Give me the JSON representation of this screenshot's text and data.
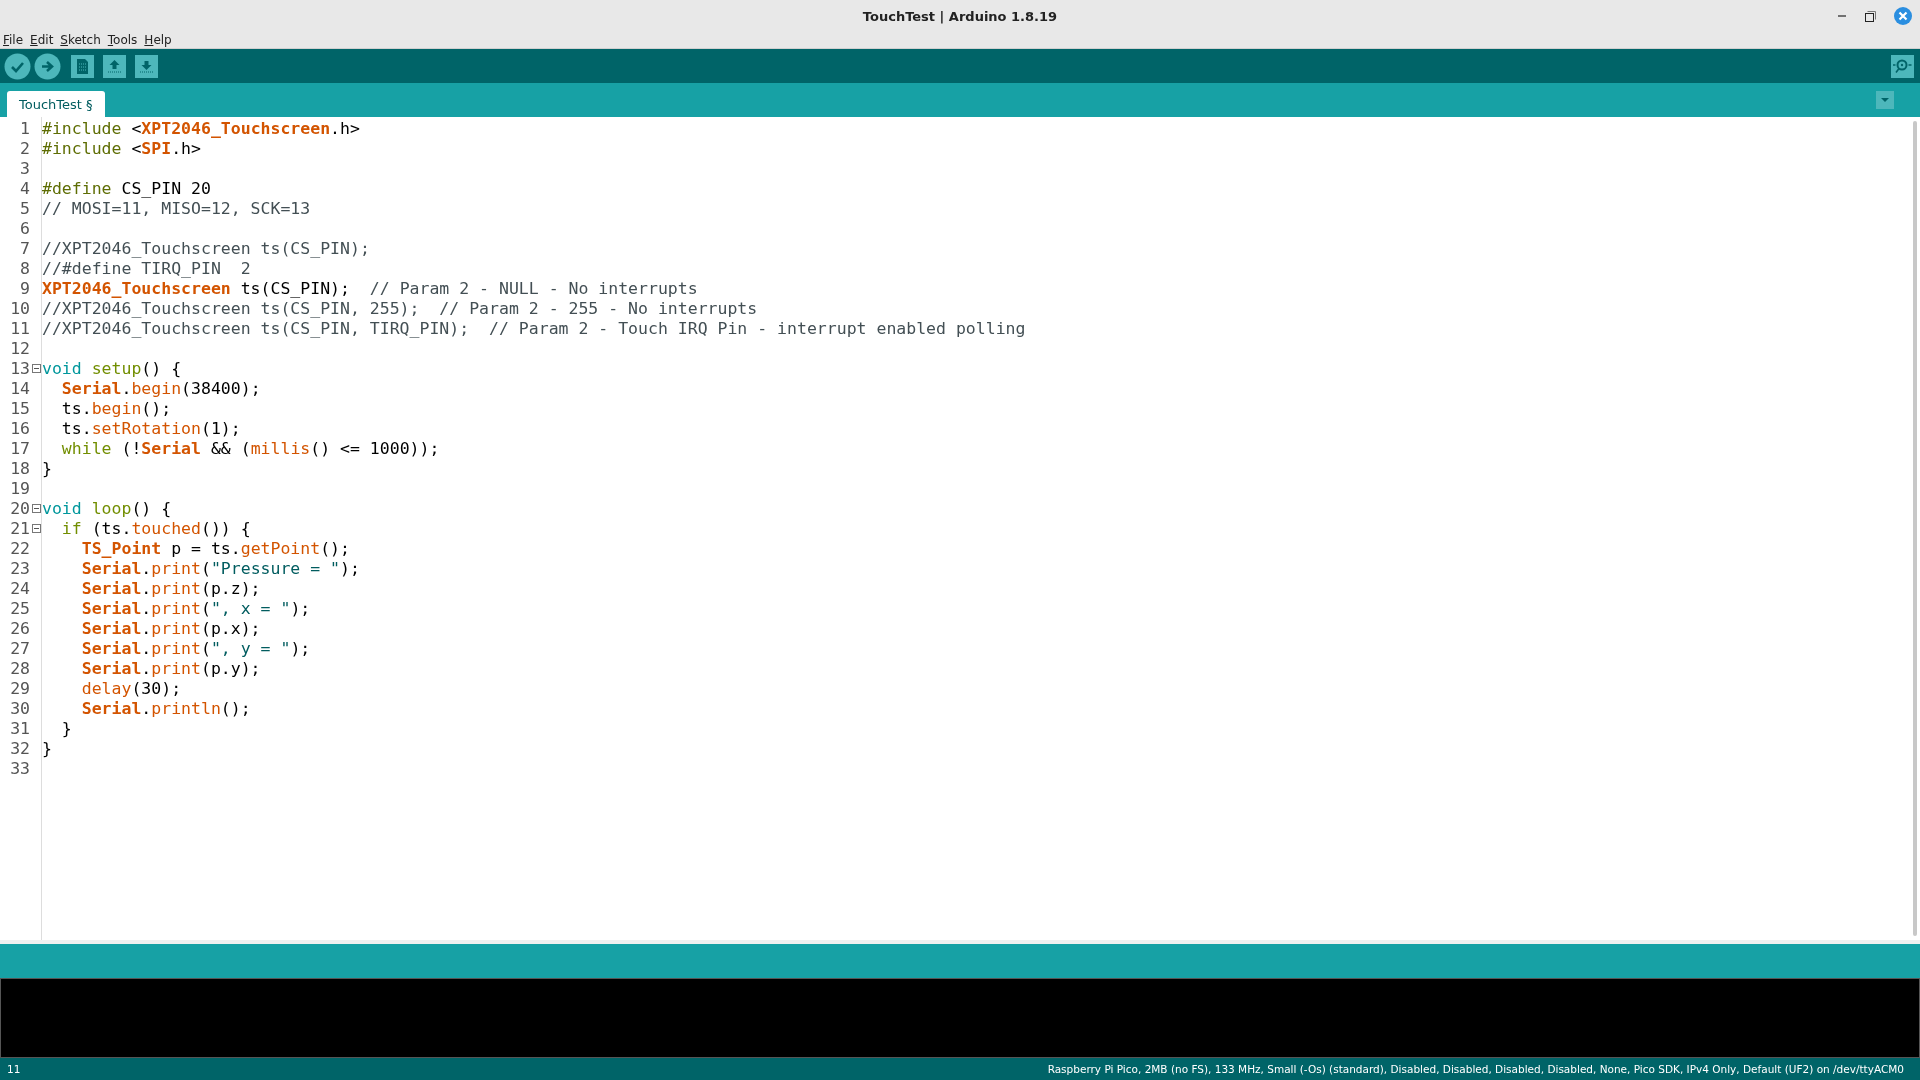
{
  "window": {
    "title": "TouchTest | Arduino 1.8.19"
  },
  "menu": [
    "File",
    "Edit",
    "Sketch",
    "Tools",
    "Help"
  ],
  "tabs": [
    {
      "label": "TouchTest §",
      "selected": true
    }
  ],
  "code_lines": [
    {
      "number": "1",
      "tokens": [
        {
          "text": "#include",
          "kind": "pre"
        },
        {
          "text": " <",
          "kind": "plain"
        },
        {
          "text": "XPT2046_Touchscreen",
          "kind": "lib"
        },
        {
          "text": ".h>",
          "kind": "plain"
        }
      ]
    },
    {
      "number": "2",
      "tokens": [
        {
          "text": "#include",
          "kind": "pre"
        },
        {
          "text": " <",
          "kind": "plain"
        },
        {
          "text": "SPI",
          "kind": "lib"
        },
        {
          "text": ".h>",
          "kind": "plain"
        }
      ]
    },
    {
      "number": "3"
    },
    {
      "number": "4",
      "tokens": [
        {
          "text": "#define",
          "kind": "pre"
        },
        {
          "text": " CS_PIN 20",
          "kind": "plain"
        }
      ]
    },
    {
      "number": "5",
      "tokens": [
        {
          "text": "// MOSI=11, MISO=12, SCK=13",
          "kind": "com"
        }
      ]
    },
    {
      "number": "6"
    },
    {
      "number": "7",
      "tokens": [
        {
          "text": "//XPT2046_Touchscreen ts(CS_PIN);",
          "kind": "com"
        }
      ]
    },
    {
      "number": "8",
      "tokens": [
        {
          "text": "//#define TIRQ_PIN  2",
          "kind": "com"
        }
      ]
    },
    {
      "number": "9",
      "tokens": [
        {
          "text": "XPT2046_Touchscreen",
          "kind": "lib"
        },
        {
          "text": " ts(CS_PIN);  ",
          "kind": "plain"
        },
        {
          "text": "// Param 2 - NULL - No interrupts",
          "kind": "com"
        }
      ]
    },
    {
      "number": "10",
      "tokens": [
        {
          "text": "//XPT2046_Touchscreen ts(CS_PIN, 255);  // Param 2 - 255 - No interrupts",
          "kind": "com"
        }
      ]
    },
    {
      "number": "11",
      "tokens": [
        {
          "text": "//XPT2046_Touchscreen ts(CS_PIN, TIRQ_PIN);  // Param 2 - Touch IRQ Pin - interrupt enabled polling",
          "kind": "com"
        }
      ]
    },
    {
      "number": "12"
    },
    {
      "number": "13",
      "fold": true,
      "tokens": [
        {
          "text": "void ",
          "kind": "type"
        },
        {
          "text": "setup",
          "kind": "kw"
        },
        {
          "text": "() {",
          "kind": "plain"
        }
      ]
    },
    {
      "number": "14",
      "tokens": [
        {
          "text": "  Serial",
          "kind": "lib"
        },
        {
          "text": ".",
          "kind": "plain"
        },
        {
          "text": "begin",
          "kind": "fn"
        },
        {
          "text": "(38400);",
          "kind": "plain"
        }
      ]
    },
    {
      "number": "15",
      "tokens": [
        {
          "text": "  ts.",
          "kind": "plain"
        },
        {
          "text": "begin",
          "kind": "fn"
        },
        {
          "text": "();",
          "kind": "plain"
        }
      ]
    },
    {
      "number": "16",
      "tokens": [
        {
          "text": "  ts.",
          "kind": "plain"
        },
        {
          "text": "setRotation",
          "kind": "fn"
        },
        {
          "text": "(1);",
          "kind": "plain"
        }
      ]
    },
    {
      "number": "17",
      "tokens": [
        {
          "text": "  while",
          "kind": "kw"
        },
        {
          "text": " (!",
          "kind": "plain"
        },
        {
          "text": "Serial",
          "kind": "lib"
        },
        {
          "text": " && (",
          "kind": "plain"
        },
        {
          "text": "millis",
          "kind": "fn"
        },
        {
          "text": "() <= 1000));",
          "kind": "plain"
        }
      ]
    },
    {
      "number": "18",
      "tokens": [
        {
          "text": "}",
          "kind": "plain"
        }
      ]
    },
    {
      "number": "19"
    },
    {
      "number": "20",
      "fold": true,
      "tokens": [
        {
          "text": "void ",
          "kind": "type"
        },
        {
          "text": "loop",
          "kind": "kw"
        },
        {
          "text": "() {",
          "kind": "plain"
        }
      ]
    },
    {
      "number": "21",
      "fold": true,
      "tokens": [
        {
          "text": "  if",
          "kind": "kw"
        },
        {
          "text": " (ts.",
          "kind": "plain"
        },
        {
          "text": "touched",
          "kind": "fn"
        },
        {
          "text": "()) {",
          "kind": "plain"
        }
      ]
    },
    {
      "number": "22",
      "tokens": [
        {
          "text": "    TS_Point",
          "kind": "lib"
        },
        {
          "text": " p = ts.",
          "kind": "plain"
        },
        {
          "text": "getPoint",
          "kind": "fn"
        },
        {
          "text": "();",
          "kind": "plain"
        }
      ]
    },
    {
      "number": "23",
      "tokens": [
        {
          "text": "    Serial",
          "kind": "lib"
        },
        {
          "text": ".",
          "kind": "plain"
        },
        {
          "text": "print",
          "kind": "fn"
        },
        {
          "text": "(",
          "kind": "plain"
        },
        {
          "text": "\"Pressure = \"",
          "kind": "str"
        },
        {
          "text": ");",
          "kind": "plain"
        }
      ]
    },
    {
      "number": "24",
      "tokens": [
        {
          "text": "    Serial",
          "kind": "lib"
        },
        {
          "text": ".",
          "kind": "plain"
        },
        {
          "text": "print",
          "kind": "fn"
        },
        {
          "text": "(p.z);",
          "kind": "plain"
        }
      ]
    },
    {
      "number": "25",
      "tokens": [
        {
          "text": "    Serial",
          "kind": "lib"
        },
        {
          "text": ".",
          "kind": "plain"
        },
        {
          "text": "print",
          "kind": "fn"
        },
        {
          "text": "(",
          "kind": "plain"
        },
        {
          "text": "\", x = \"",
          "kind": "str"
        },
        {
          "text": ");",
          "kind": "plain"
        }
      ]
    },
    {
      "number": "26",
      "tokens": [
        {
          "text": "    Serial",
          "kind": "lib"
        },
        {
          "text": ".",
          "kind": "plain"
        },
        {
          "text": "print",
          "kind": "fn"
        },
        {
          "text": "(p.x);",
          "kind": "plain"
        }
      ]
    },
    {
      "number": "27",
      "tokens": [
        {
          "text": "    Serial",
          "kind": "lib"
        },
        {
          "text": ".",
          "kind": "plain"
        },
        {
          "text": "print",
          "kind": "fn"
        },
        {
          "text": "(",
          "kind": "plain"
        },
        {
          "text": "\", y = \"",
          "kind": "str"
        },
        {
          "text": ");",
          "kind": "plain"
        }
      ]
    },
    {
      "number": "28",
      "tokens": [
        {
          "text": "    Serial",
          "kind": "lib"
        },
        {
          "text": ".",
          "kind": "plain"
        },
        {
          "text": "print",
          "kind": "fn"
        },
        {
          "text": "(p.y);",
          "kind": "plain"
        }
      ]
    },
    {
      "number": "29",
      "tokens": [
        {
          "text": "    delay",
          "kind": "fn"
        },
        {
          "text": "(30);",
          "kind": "plain"
        }
      ]
    },
    {
      "number": "30",
      "tokens": [
        {
          "text": "    Serial",
          "kind": "lib"
        },
        {
          "text": ".",
          "kind": "plain"
        },
        {
          "text": "println",
          "kind": "fn"
        },
        {
          "text": "();",
          "kind": "plain"
        }
      ]
    },
    {
      "number": "31",
      "tokens": [
        {
          "text": "  }",
          "kind": "plain"
        }
      ]
    },
    {
      "number": "32",
      "tokens": [
        {
          "text": "}",
          "kind": "plain"
        }
      ]
    },
    {
      "number": "33"
    }
  ],
  "status_bar": {
    "line": "11",
    "board": "Raspberry Pi Pico, 2MB (no FS), 133 MHz, Small (-Os) (standard), Disabled, Disabled, Disabled, Disabled, None, Pico SDK, IPv4 Only, Default (UF2) on /dev/ttyACM0"
  }
}
